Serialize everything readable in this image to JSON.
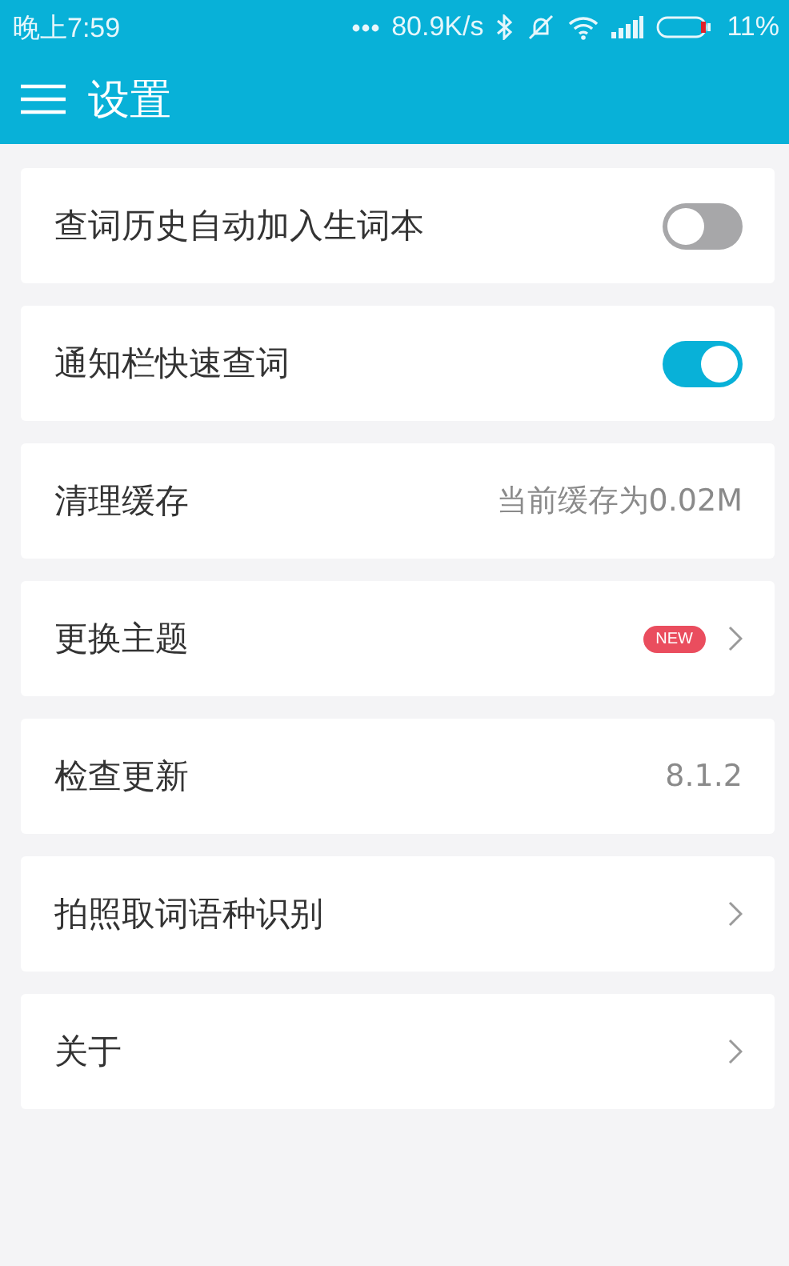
{
  "status_bar": {
    "time": "晚上7:59",
    "speed": "80.9K/s",
    "battery": "11%"
  },
  "app_bar": {
    "title": "设置"
  },
  "settings": [
    {
      "kind": "toggle",
      "label": "查词历史自动加入生词本",
      "on": false
    },
    {
      "kind": "toggle",
      "label": "通知栏快速查词",
      "on": true
    },
    {
      "kind": "value",
      "label": "清理缓存",
      "value": "当前缓存为0.02M"
    },
    {
      "kind": "link",
      "label": "更换主题",
      "badge": "NEW"
    },
    {
      "kind": "value",
      "label": "检查更新",
      "value": "8.1.2"
    },
    {
      "kind": "link",
      "label": "拍照取词语种识别"
    },
    {
      "kind": "link",
      "label": "关于"
    }
  ]
}
